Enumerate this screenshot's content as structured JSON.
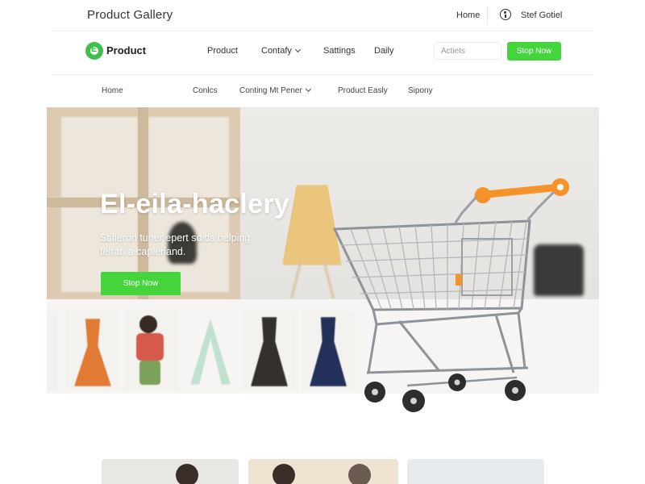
{
  "topbar": {
    "title": "Product Gallery",
    "home_label": "Home",
    "user_icon": "user-info-icon",
    "user_label": "Stef Gotiel"
  },
  "mainnav": {
    "logo_letter": "E",
    "logo_text": "Product",
    "items": [
      {
        "label": "Product",
        "has_dropdown": false
      },
      {
        "label": "Contafy",
        "has_dropdown": true
      },
      {
        "label": "Sattings",
        "has_dropdown": false
      },
      {
        "label": "Daily",
        "has_dropdown": false
      }
    ],
    "search_placeholder": "Actiets",
    "shop_button": "Stop Now"
  },
  "subnav": {
    "items": [
      {
        "label": "Home",
        "has_dropdown": false
      },
      {
        "label": "Conlcs",
        "has_dropdown": false
      },
      {
        "label": "Conting Mt Pener",
        "has_dropdown": true
      },
      {
        "label": "Product Easly",
        "has_dropdown": false
      },
      {
        "label": "Sipony",
        "has_dropdown": false
      }
    ]
  },
  "hero": {
    "heading": "El-eila-haclery",
    "subtext": "Stifleron tuner epert sdids belping telran a capleriand.",
    "button": "Stop Now"
  },
  "colors": {
    "accent_green": "#44d43c",
    "logo_green": "#3ec04a",
    "cart_handle": "#f5922a"
  }
}
